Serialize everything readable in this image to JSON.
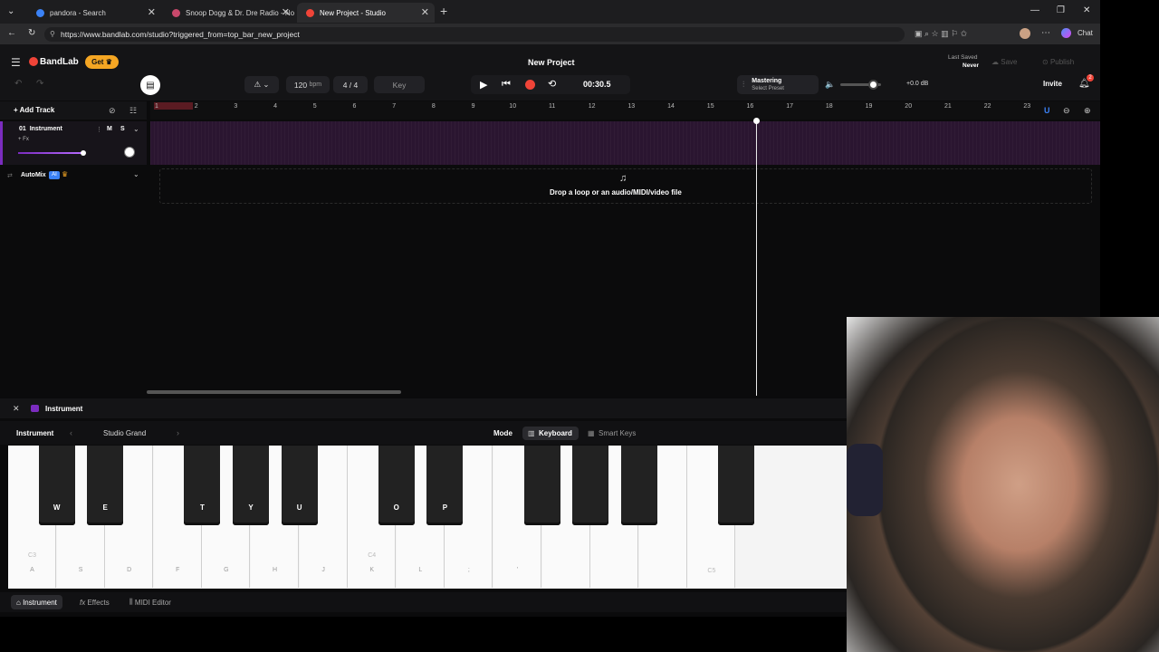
{
  "browser": {
    "tabs": [
      {
        "title": "pandora - Search",
        "favicon_color": "#3b82f6"
      },
      {
        "title": "Snoop Dogg & Dr. Dre Radio - No",
        "favicon_color": "#c8486b"
      },
      {
        "title": "New Project - Studio",
        "favicon_color": "#f04438"
      }
    ],
    "url": "https://www.bandlab.com/studio?triggered_from=top_bar_new_project",
    "chat_label": "Chat"
  },
  "studio": {
    "brand": "BandLab",
    "get_label": "Get",
    "project_title": "New Project",
    "last_saved_label": "Last Saved",
    "last_saved_value": "Never",
    "save_label": "Save",
    "publish_label": "Publish",
    "bpm_value": "120",
    "bpm_unit": "bpm",
    "time_sig": "4 / 4",
    "key_label": "Key",
    "time": "00:30.5",
    "mastering_label": "Mastering",
    "mastering_sub": "Select Preset",
    "volume_db": "+0.0 dB",
    "invite_label": "Invite",
    "notif_count": "2",
    "add_track_label": "Add Track",
    "track_number": "01",
    "track_name": "Instrument",
    "fx_label": "+ Fx",
    "mute": "M",
    "solo": "S",
    "automix_label": "AutoMix",
    "ai_badge": "AI",
    "drop_text": "Drop a loop or an audio/MIDI/video file",
    "ruler_ticks": [
      "1",
      "2",
      "3",
      "4",
      "5",
      "6",
      "7",
      "8",
      "9",
      "10",
      "11",
      "12",
      "13",
      "14",
      "15",
      "16",
      "17",
      "18",
      "19",
      "20",
      "21",
      "22",
      "23"
    ]
  },
  "panel": {
    "title": "Instrument",
    "instrument_label": "Instrument",
    "preset_name": "Studio Grand",
    "mode_label": "Mode",
    "keyboard_label": "Keyboard",
    "smart_keys_label": "Smart Keys",
    "black_key_labels": [
      "W",
      "E",
      "",
      "T",
      "Y",
      "U",
      "",
      "O",
      "P",
      "",
      "",
      "",
      "",
      "",
      ""
    ],
    "white_key_labels": [
      "A",
      "S",
      "D",
      "F",
      "G",
      "H",
      "J",
      "K",
      "L",
      ";",
      "'",
      "",
      "",
      "",
      ""
    ],
    "octave_labels": [
      "C3",
      "C4",
      "C5"
    ],
    "bottom_tabs": [
      "Instrument",
      "Effects",
      "MIDI Editor"
    ]
  },
  "colors": {
    "accent": "#7b2cbf",
    "record": "#f04438",
    "get_badge": "#f5a623"
  }
}
